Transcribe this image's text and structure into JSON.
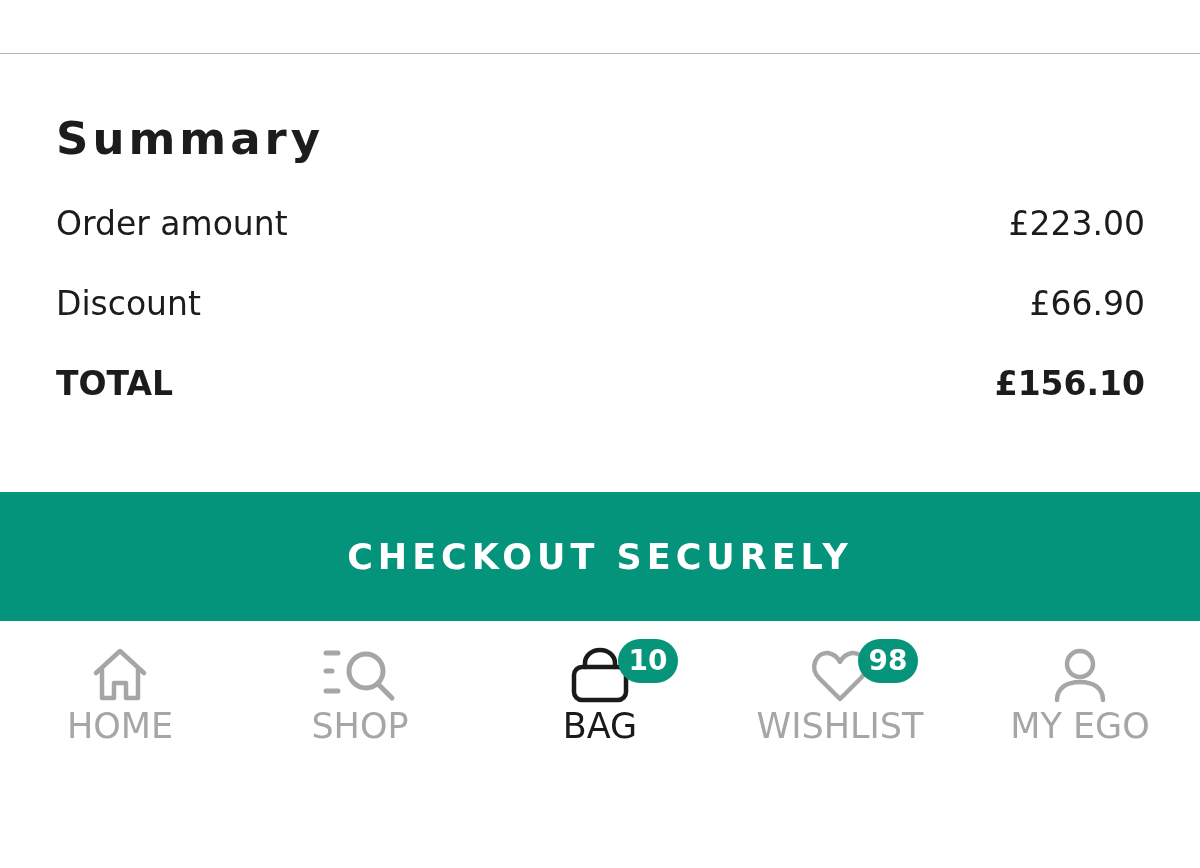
{
  "summary": {
    "title": "Summary",
    "rows": [
      {
        "kind": "line",
        "label": "Order amount",
        "value": "£223.00"
      },
      {
        "kind": "line",
        "label": "Discount",
        "value": "£66.90"
      },
      {
        "kind": "total",
        "label": "TOTAL",
        "value": "£156.10"
      }
    ]
  },
  "checkout_button": {
    "label": "CHECKOUT SECURELY"
  },
  "bottom_nav": [
    {
      "label": "HOME",
      "selected": false
    },
    {
      "label": "SHOP",
      "selected": false
    },
    {
      "label": "BAG",
      "selected": true,
      "badge": "10"
    },
    {
      "label": "WISHLIST",
      "selected": false,
      "badge": "98"
    },
    {
      "label": "MY EGO",
      "selected": false
    }
  ]
}
